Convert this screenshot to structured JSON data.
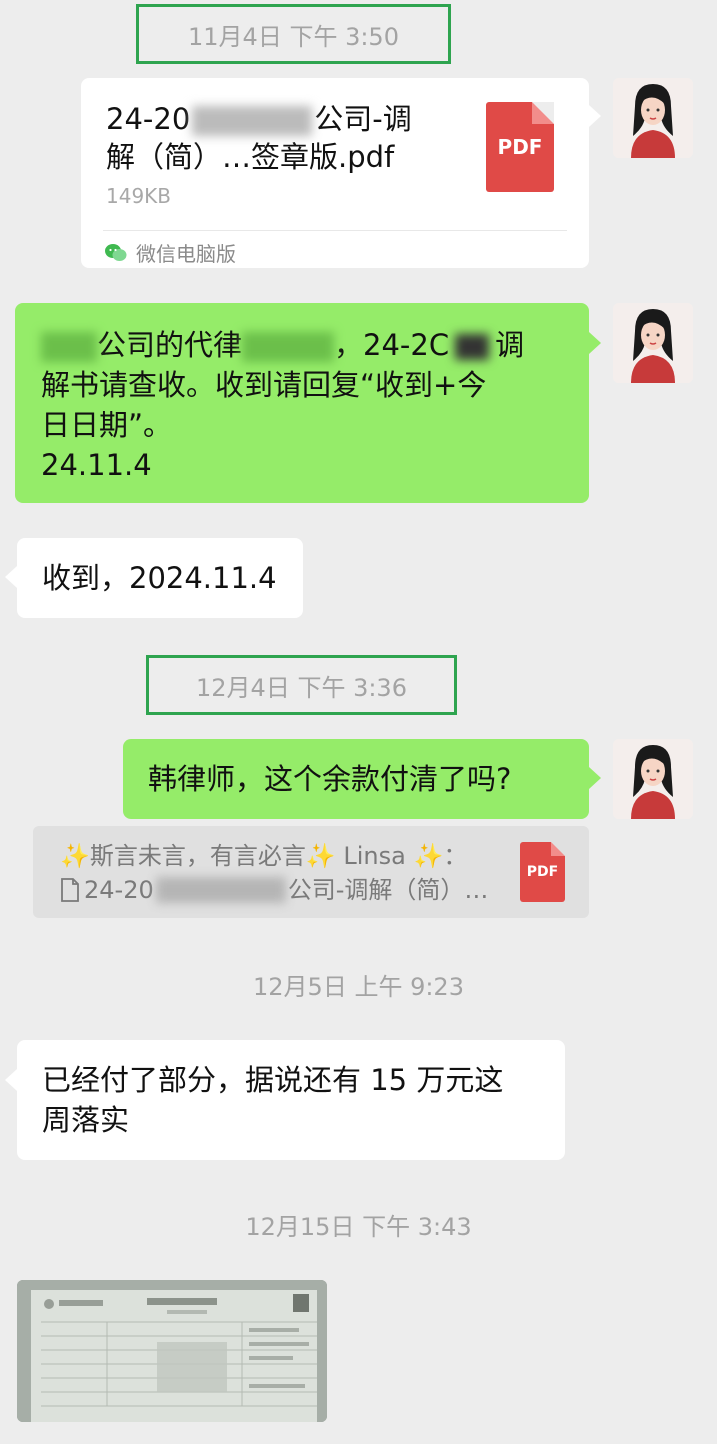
{
  "timestamps": [
    "11月4日 下午 3:50",
    "12月4日 下午 3:36",
    "12月5日 上午 9:23",
    "12月15日 下午 3:43"
  ],
  "file_card": {
    "title_line1_prefix": "24-20",
    "title_line1_suffix": "公司-调",
    "title_line2": "解（简）…签章版.pdf",
    "size": "149KB",
    "icon_label": "PDF",
    "source": "微信电脑版"
  },
  "msg1": {
    "line1_a": "公司的代律",
    "line1_b": "，24-2C",
    "line1_c": "调",
    "line2": "解书请查收。收到请回复“收到+今",
    "line3": "日日期”。",
    "line4": "24.11.4"
  },
  "msg2": "收到，2024.11.4",
  "msg3": "韩律师，这个余款付清了吗?",
  "quote": {
    "line1": "✨斯言未言，有言必言✨ Linsa ✨：",
    "line2_prefix": "24-20",
    "line2_suffix": "公司-调解（简）…",
    "icon_label": "PDF"
  },
  "msg4": {
    "line1": "已经付了部分，据说还有 15 万元这",
    "line2": "周落实"
  }
}
